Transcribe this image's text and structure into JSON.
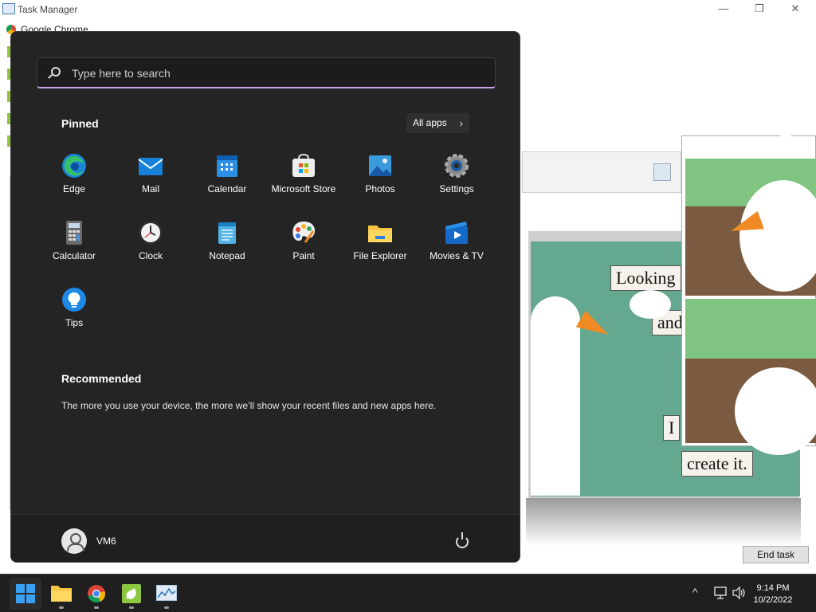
{
  "background_window": {
    "title": "Task Manager",
    "first_row": "Google Chrome",
    "end_task_label": "End task",
    "controls": {
      "minimize": "—",
      "maximize": "❐",
      "close": "✕"
    }
  },
  "comic": {
    "captions": [
      "Looking",
      "and",
      "I",
      "create it."
    ]
  },
  "start_menu": {
    "search_placeholder": "Type here to search",
    "pinned_heading": "Pinned",
    "all_apps_label": "All apps",
    "pinned_apps": [
      {
        "label": "Edge",
        "icon": "edge-icon"
      },
      {
        "label": "Mail",
        "icon": "mail-icon"
      },
      {
        "label": "Calendar",
        "icon": "calendar-icon"
      },
      {
        "label": "Microsoft Store",
        "icon": "store-icon"
      },
      {
        "label": "Photos",
        "icon": "photos-icon"
      },
      {
        "label": "Settings",
        "icon": "settings-icon"
      },
      {
        "label": "Calculator",
        "icon": "calculator-icon"
      },
      {
        "label": "Clock",
        "icon": "clock-icon"
      },
      {
        "label": "Notepad",
        "icon": "notepad-icon"
      },
      {
        "label": "Paint",
        "icon": "paint-icon"
      },
      {
        "label": "File Explorer",
        "icon": "folder-icon"
      },
      {
        "label": "Movies & TV",
        "icon": "movies-icon"
      },
      {
        "label": "Tips",
        "icon": "tips-icon"
      }
    ],
    "recommended_heading": "Recommended",
    "recommended_text": "The more you use your device, the more we’ll show your recent files and new apps here.",
    "user_name": "VM6"
  },
  "taskbar": {
    "apps": [
      "start-icon",
      "file-explorer-icon",
      "chrome-icon",
      "goose-app-icon",
      "task-manager-icon"
    ],
    "time": "9:14 PM",
    "date": "10/2/2022"
  },
  "colors": {
    "accent": "#c9a8e8",
    "menu_bg": "#242424",
    "taskbar_bg": "#1f1f1f"
  }
}
